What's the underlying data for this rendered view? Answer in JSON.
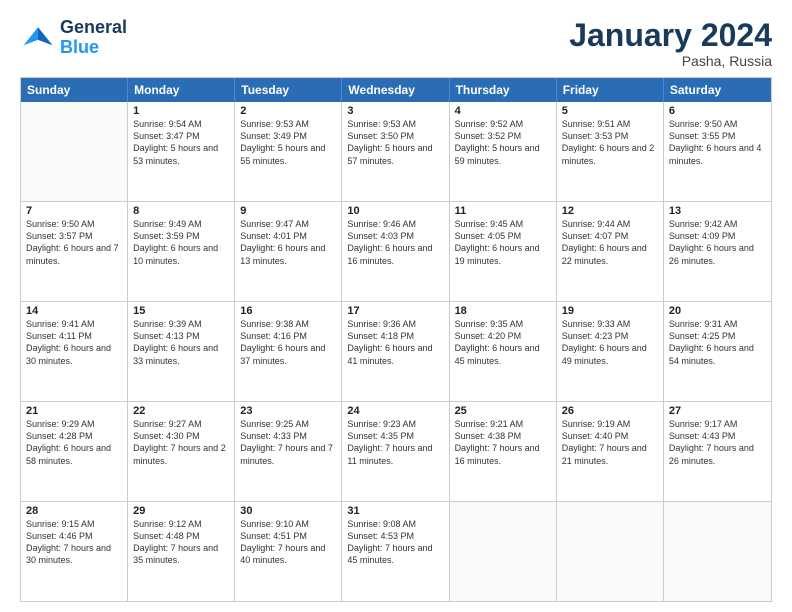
{
  "logo": {
    "line1": "General",
    "line2": "Blue"
  },
  "title": "January 2024",
  "subtitle": "Pasha, Russia",
  "days": [
    "Sunday",
    "Monday",
    "Tuesday",
    "Wednesday",
    "Thursday",
    "Friday",
    "Saturday"
  ],
  "rows": [
    [
      {
        "day": "",
        "empty": true
      },
      {
        "day": "1",
        "sunrise": "9:54 AM",
        "sunset": "3:47 PM",
        "daylight": "5 hours and 53 minutes."
      },
      {
        "day": "2",
        "sunrise": "9:53 AM",
        "sunset": "3:49 PM",
        "daylight": "5 hours and 55 minutes."
      },
      {
        "day": "3",
        "sunrise": "9:53 AM",
        "sunset": "3:50 PM",
        "daylight": "5 hours and 57 minutes."
      },
      {
        "day": "4",
        "sunrise": "9:52 AM",
        "sunset": "3:52 PM",
        "daylight": "5 hours and 59 minutes."
      },
      {
        "day": "5",
        "sunrise": "9:51 AM",
        "sunset": "3:53 PM",
        "daylight": "6 hours and 2 minutes."
      },
      {
        "day": "6",
        "sunrise": "9:50 AM",
        "sunset": "3:55 PM",
        "daylight": "6 hours and 4 minutes."
      }
    ],
    [
      {
        "day": "7",
        "sunrise": "9:50 AM",
        "sunset": "3:57 PM",
        "daylight": "6 hours and 7 minutes."
      },
      {
        "day": "8",
        "sunrise": "9:49 AM",
        "sunset": "3:59 PM",
        "daylight": "6 hours and 10 minutes."
      },
      {
        "day": "9",
        "sunrise": "9:47 AM",
        "sunset": "4:01 PM",
        "daylight": "6 hours and 13 minutes."
      },
      {
        "day": "10",
        "sunrise": "9:46 AM",
        "sunset": "4:03 PM",
        "daylight": "6 hours and 16 minutes."
      },
      {
        "day": "11",
        "sunrise": "9:45 AM",
        "sunset": "4:05 PM",
        "daylight": "6 hours and 19 minutes."
      },
      {
        "day": "12",
        "sunrise": "9:44 AM",
        "sunset": "4:07 PM",
        "daylight": "6 hours and 22 minutes."
      },
      {
        "day": "13",
        "sunrise": "9:42 AM",
        "sunset": "4:09 PM",
        "daylight": "6 hours and 26 minutes."
      }
    ],
    [
      {
        "day": "14",
        "sunrise": "9:41 AM",
        "sunset": "4:11 PM",
        "daylight": "6 hours and 30 minutes."
      },
      {
        "day": "15",
        "sunrise": "9:39 AM",
        "sunset": "4:13 PM",
        "daylight": "6 hours and 33 minutes."
      },
      {
        "day": "16",
        "sunrise": "9:38 AM",
        "sunset": "4:16 PM",
        "daylight": "6 hours and 37 minutes."
      },
      {
        "day": "17",
        "sunrise": "9:36 AM",
        "sunset": "4:18 PM",
        "daylight": "6 hours and 41 minutes."
      },
      {
        "day": "18",
        "sunrise": "9:35 AM",
        "sunset": "4:20 PM",
        "daylight": "6 hours and 45 minutes."
      },
      {
        "day": "19",
        "sunrise": "9:33 AM",
        "sunset": "4:23 PM",
        "daylight": "6 hours and 49 minutes."
      },
      {
        "day": "20",
        "sunrise": "9:31 AM",
        "sunset": "4:25 PM",
        "daylight": "6 hours and 54 minutes."
      }
    ],
    [
      {
        "day": "21",
        "sunrise": "9:29 AM",
        "sunset": "4:28 PM",
        "daylight": "6 hours and 58 minutes."
      },
      {
        "day": "22",
        "sunrise": "9:27 AM",
        "sunset": "4:30 PM",
        "daylight": "7 hours and 2 minutes."
      },
      {
        "day": "23",
        "sunrise": "9:25 AM",
        "sunset": "4:33 PM",
        "daylight": "7 hours and 7 minutes."
      },
      {
        "day": "24",
        "sunrise": "9:23 AM",
        "sunset": "4:35 PM",
        "daylight": "7 hours and 11 minutes."
      },
      {
        "day": "25",
        "sunrise": "9:21 AM",
        "sunset": "4:38 PM",
        "daylight": "7 hours and 16 minutes."
      },
      {
        "day": "26",
        "sunrise": "9:19 AM",
        "sunset": "4:40 PM",
        "daylight": "7 hours and 21 minutes."
      },
      {
        "day": "27",
        "sunrise": "9:17 AM",
        "sunset": "4:43 PM",
        "daylight": "7 hours and 26 minutes."
      }
    ],
    [
      {
        "day": "28",
        "sunrise": "9:15 AM",
        "sunset": "4:46 PM",
        "daylight": "7 hours and 30 minutes."
      },
      {
        "day": "29",
        "sunrise": "9:12 AM",
        "sunset": "4:48 PM",
        "daylight": "7 hours and 35 minutes."
      },
      {
        "day": "30",
        "sunrise": "9:10 AM",
        "sunset": "4:51 PM",
        "daylight": "7 hours and 40 minutes."
      },
      {
        "day": "31",
        "sunrise": "9:08 AM",
        "sunset": "4:53 PM",
        "daylight": "7 hours and 45 minutes."
      },
      {
        "day": "",
        "empty": true
      },
      {
        "day": "",
        "empty": true
      },
      {
        "day": "",
        "empty": true
      }
    ]
  ]
}
